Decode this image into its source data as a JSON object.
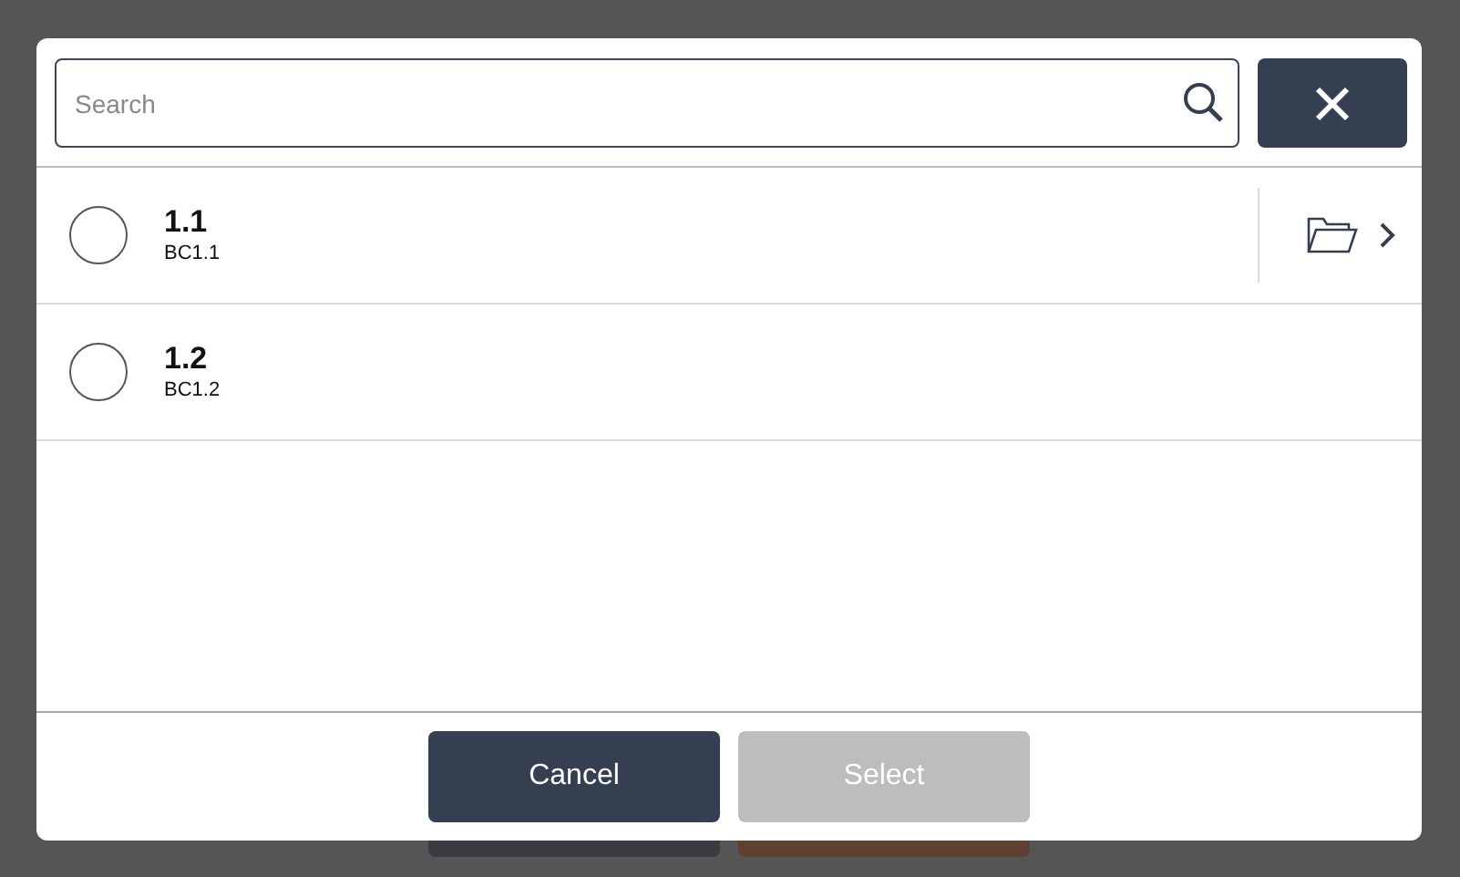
{
  "search": {
    "placeholder": "Search"
  },
  "items": [
    {
      "title": "1.1",
      "subtitle": "BC1.1",
      "selected": false,
      "expandable": true
    },
    {
      "title": "1.2",
      "subtitle": "BC1.2",
      "selected": false,
      "expandable": false
    }
  ],
  "buttons": [
    {
      "label": "Cancel",
      "kind": "secondary",
      "disabled": false
    },
    {
      "label": "Select",
      "kind": "primary",
      "disabled": true
    }
  ]
}
